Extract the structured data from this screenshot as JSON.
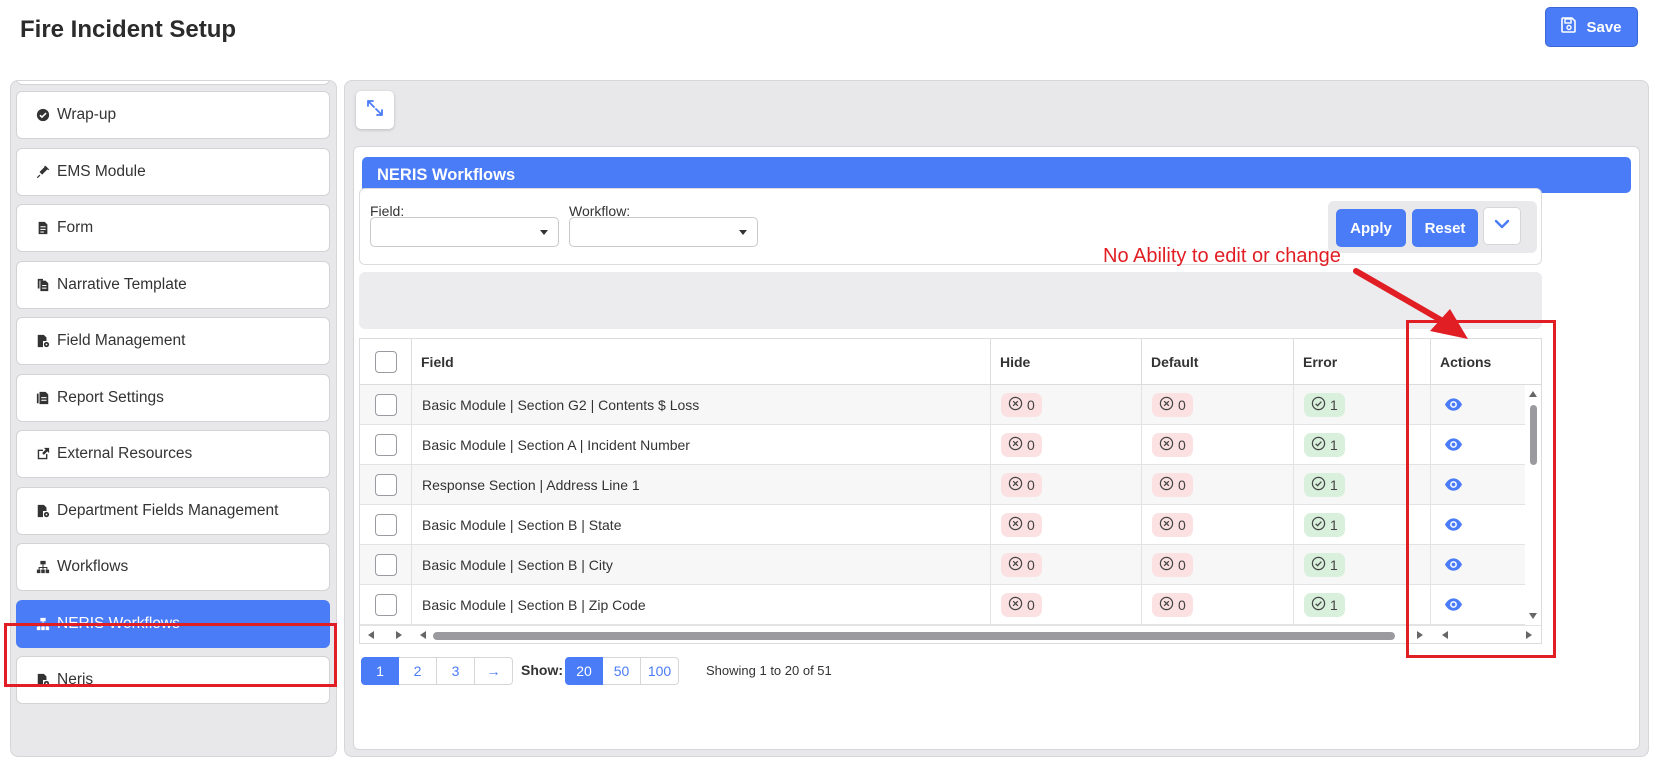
{
  "page": {
    "title": "Fire Incident Setup",
    "save_label": "Save"
  },
  "sidebar": {
    "items": [
      {
        "label": "Wrap-up",
        "icon": "check-circle-icon"
      },
      {
        "label": "EMS Module",
        "icon": "syringe-icon"
      },
      {
        "label": "Form",
        "icon": "file-icon"
      },
      {
        "label": "Narrative Template",
        "icon": "copy-icon"
      },
      {
        "label": "Field Management",
        "icon": "file-gear-icon"
      },
      {
        "label": "Report Settings",
        "icon": "file-report-icon"
      },
      {
        "label": "External Resources",
        "icon": "external-link-icon"
      },
      {
        "label": "Department Fields Management",
        "icon": "file-gear-icon"
      },
      {
        "label": "Workflows",
        "icon": "sitemap-icon"
      },
      {
        "label": "NERIS Workflows",
        "icon": "sitemap-icon",
        "active": true
      },
      {
        "label": "Neris",
        "icon": "file-gear-icon"
      }
    ]
  },
  "card": {
    "title": "NERIS Workflows"
  },
  "filters": {
    "field_label": "Field:",
    "workflow_label": "Workflow:",
    "field_value": "",
    "workflow_value": "",
    "apply_label": "Apply",
    "reset_label": "Reset"
  },
  "annotation": {
    "text": "No Ability to edit or change",
    "color": "#e01e24"
  },
  "table": {
    "columns": [
      "Field",
      "Hide",
      "Default",
      "Error",
      "Actions"
    ],
    "rows": [
      {
        "field": "Basic Module | Section G2 | Contents $ Loss",
        "hide": "0",
        "default": "0",
        "error": "1"
      },
      {
        "field": "Basic Module | Section A | Incident Number",
        "hide": "0",
        "default": "0",
        "error": "1"
      },
      {
        "field": "Response Section | Address Line 1",
        "hide": "0",
        "default": "0",
        "error": "1"
      },
      {
        "field": "Basic Module | Section B | State",
        "hide": "0",
        "default": "0",
        "error": "1"
      },
      {
        "field": "Basic Module | Section B | City",
        "hide": "0",
        "default": "0",
        "error": "1"
      },
      {
        "field": "Basic Module | Section B | Zip Code",
        "hide": "0",
        "default": "0",
        "error": "1"
      }
    ]
  },
  "pagination": {
    "pages": [
      "1",
      "2",
      "3",
      "→"
    ],
    "current_page": "1",
    "show_label": "Show:",
    "sizes": [
      "20",
      "50",
      "100"
    ],
    "current_size": "20",
    "summary": "Showing 1 to 20 of 51"
  },
  "colors": {
    "accent": "#4a7cf7",
    "annotation": "#e01e24",
    "badge_red_bg": "#fbe1e2",
    "badge_green_bg": "#d9f0dd"
  }
}
